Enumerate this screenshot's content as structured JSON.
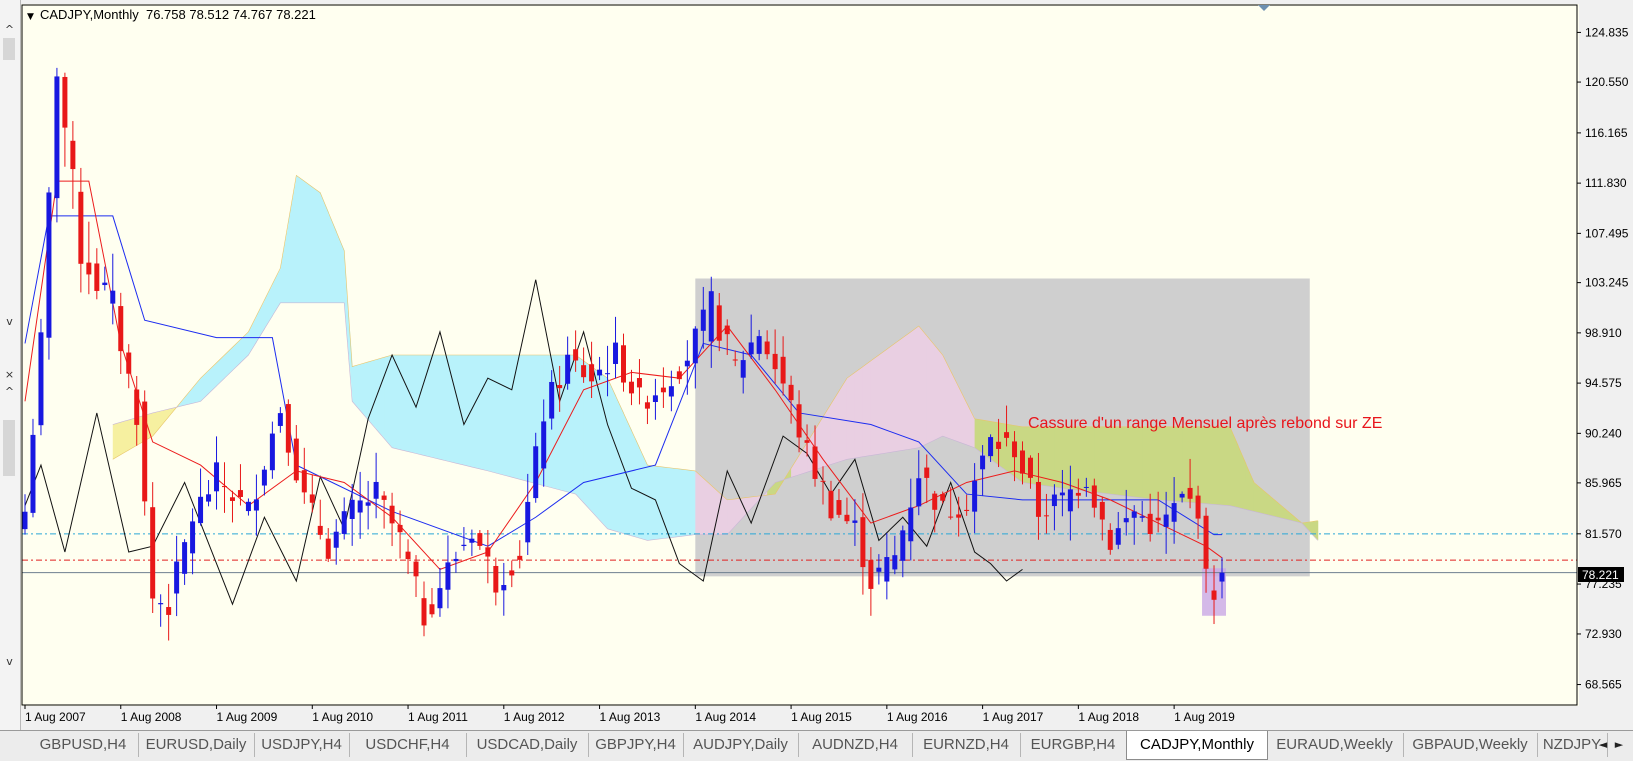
{
  "window": {
    "info_caret": "▼"
  },
  "left_strip": {
    "close_icon": "×",
    "arrow_up": "^",
    "arrow_down": "v"
  },
  "tabs": {
    "items": [
      {
        "label": "GBPUSD,H4",
        "active": false
      },
      {
        "label": "EURUSD,Daily",
        "active": false
      },
      {
        "label": "USDJPY,H4",
        "active": false
      },
      {
        "label": "USDCHF,H4",
        "active": false
      },
      {
        "label": "USDCAD,Daily",
        "active": false
      },
      {
        "label": "GBPJPY,H4",
        "active": false
      },
      {
        "label": "AUDJPY,Daily",
        "active": false
      },
      {
        "label": "AUDNZD,H4",
        "active": false
      },
      {
        "label": "EURNZD,H4",
        "active": false
      },
      {
        "label": "EURGBP,H4",
        "active": false
      },
      {
        "label": "CADJPY,Monthly",
        "active": true
      },
      {
        "label": "EURAUD,Weekly",
        "active": false
      },
      {
        "label": "GBPAUD,Weekly",
        "active": false
      },
      {
        "label": "NZDJPY",
        "active": false
      }
    ],
    "arrow_left": "◄",
    "arrow_right": "►"
  },
  "chart_data": {
    "type": "candlestick",
    "symbol_info": "CADJPY,Monthly  76.758 78.512 74.767 78.221",
    "annotation": "Cassure d'un range Mensuel après rebond sur ZE",
    "ylim": [
      66.8,
      127.2
    ],
    "price_ticks": [
      "124.835",
      "120.550",
      "116.165",
      "111.830",
      "107.495",
      "103.245",
      "98.910",
      "94.575",
      "90.240",
      "85.965",
      "81.570",
      "77.235",
      "72.930",
      "68.565"
    ],
    "current_price": "78.221",
    "x_labels": [
      "1 Aug 2007",
      "1 Aug 2008",
      "1 Aug 2009",
      "1 Aug 2010",
      "1 Aug 2011",
      "1 Aug 2012",
      "1 Aug 2013",
      "1 Aug 2014",
      "1 Aug 2015",
      "1 Aug 2016",
      "1 Aug 2017",
      "1 Aug 2018",
      "1 Aug 2019"
    ],
    "start_month": "2007-08",
    "horizontal_lines": [
      {
        "price": 81.57,
        "color": "#2aa6d6",
        "style": "dashdot"
      },
      {
        "price": 79.3,
        "color": "#e02020",
        "style": "dashdot"
      },
      {
        "price": 78.221,
        "color": "#6e7f8f",
        "style": "solid"
      }
    ],
    "range_box": {
      "from": "2014-08",
      "to": "2021-01",
      "high": 103.6,
      "low": 77.9,
      "color": "#cfcfcf"
    },
    "zone_box": {
      "from": "2019-12",
      "to": "2020-02",
      "high": 78.6,
      "low": 74.5,
      "color": "#c9a8e6"
    },
    "anchors": [
      {
        "m": "2007-08",
        "c": 83.5
      },
      {
        "m": "2007-10",
        "c": 98.0
      },
      {
        "m": "2007-12",
        "c": 122.0
      },
      {
        "m": "2008-03",
        "c": 106.0
      },
      {
        "m": "2008-07",
        "c": 101.0
      },
      {
        "m": "2008-10",
        "c": 92.0
      },
      {
        "m": "2008-12",
        "c": 76.0
      },
      {
        "m": "2009-02",
        "c": 75.5
      },
      {
        "m": "2009-05",
        "c": 83.0
      },
      {
        "m": "2009-08",
        "c": 86.5
      },
      {
        "m": "2009-12",
        "c": 83.5
      },
      {
        "m": "2010-04",
        "c": 92.5
      },
      {
        "m": "2010-07",
        "c": 84.5
      },
      {
        "m": "2010-10",
        "c": 80.5
      },
      {
        "m": "2011-01",
        "c": 83.5
      },
      {
        "m": "2011-04",
        "c": 85.0
      },
      {
        "m": "2011-07",
        "c": 81.0
      },
      {
        "m": "2011-10",
        "c": 74.5
      },
      {
        "m": "2012-01",
        "c": 78.5
      },
      {
        "m": "2012-04",
        "c": 82.0
      },
      {
        "m": "2012-07",
        "c": 77.5
      },
      {
        "m": "2012-10",
        "c": 80.0
      },
      {
        "m": "2013-01",
        "c": 92.0
      },
      {
        "m": "2013-04",
        "c": 96.5
      },
      {
        "m": "2013-07",
        "c": 95.0
      },
      {
        "m": "2013-10",
        "c": 97.0
      },
      {
        "m": "2014-01",
        "c": 93.0
      },
      {
        "m": "2014-04",
        "c": 94.5
      },
      {
        "m": "2014-07",
        "c": 97.0
      },
      {
        "m": "2014-10",
        "c": 101.0
      },
      {
        "m": "2015-01",
        "c": 96.0
      },
      {
        "m": "2015-04",
        "c": 99.0
      },
      {
        "m": "2015-07",
        "c": 94.5
      },
      {
        "m": "2015-10",
        "c": 88.5
      },
      {
        "m": "2016-01",
        "c": 84.0
      },
      {
        "m": "2016-04",
        "c": 82.0
      },
      {
        "m": "2016-06",
        "c": 77.5
      },
      {
        "m": "2016-09",
        "c": 79.5
      },
      {
        "m": "2016-12",
        "c": 87.0
      },
      {
        "m": "2017-03",
        "c": 83.5
      },
      {
        "m": "2017-06",
        "c": 84.5
      },
      {
        "m": "2017-09",
        "c": 89.5
      },
      {
        "m": "2017-12",
        "c": 89.0
      },
      {
        "m": "2018-03",
        "c": 83.5
      },
      {
        "m": "2018-06",
        "c": 84.5
      },
      {
        "m": "2018-09",
        "c": 86.5
      },
      {
        "m": "2018-12",
        "c": 81.0
      },
      {
        "m": "2019-03",
        "c": 83.5
      },
      {
        "m": "2019-06",
        "c": 82.0
      },
      {
        "m": "2019-09",
        "c": 84.5
      },
      {
        "m": "2019-11",
        "c": 84.0
      },
      {
        "m": "2019-12",
        "c": 77.5
      },
      {
        "m": "2020-01",
        "c": 76.8
      },
      {
        "m": "2020-02",
        "c": 78.221
      }
    ],
    "kumo_a": [
      {
        "m": "2008-07",
        "v": 88.0
      },
      {
        "m": "2008-12",
        "v": 90.0
      },
      {
        "m": "2009-06",
        "v": 95.0
      },
      {
        "m": "2009-12",
        "v": 99.0
      },
      {
        "m": "2010-04",
        "v": 104.5
      },
      {
        "m": "2010-06",
        "v": 112.5
      },
      {
        "m": "2010-09",
        "v": 111.0
      },
      {
        "m": "2010-12",
        "v": 106.0
      },
      {
        "m": "2011-01",
        "v": 96.0
      },
      {
        "m": "2011-06",
        "v": 97.0
      },
      {
        "m": "2012-06",
        "v": 97.0
      },
      {
        "m": "2013-05",
        "v": 97.0
      },
      {
        "m": "2013-09",
        "v": 95.0
      },
      {
        "m": "2014-02",
        "v": 87.5
      },
      {
        "m": "2014-08",
        "v": 87.0
      },
      {
        "m": "2014-12",
        "v": 84.5
      },
      {
        "m": "2015-06",
        "v": 85.0
      },
      {
        "m": "2016-03",
        "v": 95.0
      },
      {
        "m": "2016-12",
        "v": 99.5
      },
      {
        "m": "2017-03",
        "v": 97.0
      },
      {
        "m": "2017-07",
        "v": 91.5
      },
      {
        "m": "2018-01",
        "v": 90.8
      },
      {
        "m": "2018-06",
        "v": 90.8
      },
      {
        "m": "2019-06",
        "v": 90.8
      },
      {
        "m": "2020-03",
        "v": 90.8
      },
      {
        "m": "2020-06",
        "v": 86.0
      },
      {
        "m": "2020-12",
        "v": 82.5
      },
      {
        "m": "2021-02",
        "v": 82.7
      }
    ],
    "kumo_b": [
      {
        "m": "2008-07",
        "v": 91.0
      },
      {
        "m": "2008-12",
        "v": 92.0
      },
      {
        "m": "2009-06",
        "v": 93.0
      },
      {
        "m": "2009-12",
        "v": 97.0
      },
      {
        "m": "2010-04",
        "v": 101.5
      },
      {
        "m": "2010-06",
        "v": 101.5
      },
      {
        "m": "2010-09",
        "v": 101.5
      },
      {
        "m": "2010-12",
        "v": 101.5
      },
      {
        "m": "2011-01",
        "v": 93.0
      },
      {
        "m": "2011-06",
        "v": 89.0
      },
      {
        "m": "2012-06",
        "v": 87.0
      },
      {
        "m": "2013-05",
        "v": 85.0
      },
      {
        "m": "2013-09",
        "v": 82.0
      },
      {
        "m": "2014-02",
        "v": 81.0
      },
      {
        "m": "2014-08",
        "v": 81.5
      },
      {
        "m": "2014-12",
        "v": 81.5
      },
      {
        "m": "2015-06",
        "v": 86.0
      },
      {
        "m": "2016-03",
        "v": 88.0
      },
      {
        "m": "2016-12",
        "v": 89.0
      },
      {
        "m": "2017-03",
        "v": 90.0
      },
      {
        "m": "2017-07",
        "v": 89.0
      },
      {
        "m": "2018-01",
        "v": 86.0
      },
      {
        "m": "2018-06",
        "v": 85.5
      },
      {
        "m": "2019-06",
        "v": 84.5
      },
      {
        "m": "2020-03",
        "v": 84.0
      },
      {
        "m": "2020-06",
        "v": 83.5
      },
      {
        "m": "2020-12",
        "v": 82.5
      },
      {
        "m": "2021-02",
        "v": 81.0
      }
    ],
    "tenkan": [
      {
        "m": "2007-08",
        "v": 93.0
      },
      {
        "m": "2007-12",
        "v": 112.0
      },
      {
        "m": "2008-04",
        "v": 112.0
      },
      {
        "m": "2008-08",
        "v": 98.0
      },
      {
        "m": "2008-12",
        "v": 89.5
      },
      {
        "m": "2009-06",
        "v": 87.5
      },
      {
        "m": "2009-12",
        "v": 84.0
      },
      {
        "m": "2010-06",
        "v": 87.0
      },
      {
        "m": "2010-12",
        "v": 86.0
      },
      {
        "m": "2011-06",
        "v": 83.0
      },
      {
        "m": "2011-12",
        "v": 78.5
      },
      {
        "m": "2012-06",
        "v": 80.0
      },
      {
        "m": "2012-12",
        "v": 86.0
      },
      {
        "m": "2013-06",
        "v": 94.0
      },
      {
        "m": "2013-12",
        "v": 95.5
      },
      {
        "m": "2014-06",
        "v": 95.0
      },
      {
        "m": "2014-12",
        "v": 99.5
      },
      {
        "m": "2015-06",
        "v": 94.0
      },
      {
        "m": "2015-12",
        "v": 88.0
      },
      {
        "m": "2016-06",
        "v": 82.5
      },
      {
        "m": "2016-12",
        "v": 84.0
      },
      {
        "m": "2017-06",
        "v": 86.0
      },
      {
        "m": "2017-12",
        "v": 87.0
      },
      {
        "m": "2018-06",
        "v": 86.0
      },
      {
        "m": "2018-12",
        "v": 84.5
      },
      {
        "m": "2019-06",
        "v": 82.5
      },
      {
        "m": "2019-12",
        "v": 80.5
      },
      {
        "m": "2020-02",
        "v": 79.5
      }
    ],
    "kijun": [
      {
        "m": "2007-08",
        "v": 98.0
      },
      {
        "m": "2007-11",
        "v": 109.0
      },
      {
        "m": "2008-03",
        "v": 109.0
      },
      {
        "m": "2008-07",
        "v": 109.0
      },
      {
        "m": "2008-11",
        "v": 100.0
      },
      {
        "m": "2009-08",
        "v": 98.5
      },
      {
        "m": "2010-03",
        "v": 98.5
      },
      {
        "m": "2010-06",
        "v": 87.5
      },
      {
        "m": "2011-06",
        "v": 83.5
      },
      {
        "m": "2012-06",
        "v": 80.5
      },
      {
        "m": "2012-12",
        "v": 83.0
      },
      {
        "m": "2013-06",
        "v": 86.0
      },
      {
        "m": "2014-03",
        "v": 87.5
      },
      {
        "m": "2014-09",
        "v": 98.0
      },
      {
        "m": "2015-03",
        "v": 97.0
      },
      {
        "m": "2015-09",
        "v": 92.0
      },
      {
        "m": "2016-06",
        "v": 91.0
      },
      {
        "m": "2016-12",
        "v": 89.5
      },
      {
        "m": "2017-06",
        "v": 85.0
      },
      {
        "m": "2018-01",
        "v": 84.5
      },
      {
        "m": "2018-08",
        "v": 84.5
      },
      {
        "m": "2019-06",
        "v": 84.5
      },
      {
        "m": "2020-01",
        "v": 81.5
      },
      {
        "m": "2020-02",
        "v": 81.5
      }
    ],
    "chikou": [
      {
        "m": "2007-08",
        "v": 84.0
      },
      {
        "m": "2007-10",
        "v": 87.5
      },
      {
        "m": "2008-01",
        "v": 80.0
      },
      {
        "m": "2008-05",
        "v": 92.0
      },
      {
        "m": "2008-09",
        "v": 80.0
      },
      {
        "m": "2008-12",
        "v": 80.5
      },
      {
        "m": "2009-04",
        "v": 86.0
      },
      {
        "m": "2009-08",
        "v": 79.0
      },
      {
        "m": "2009-10",
        "v": 75.5
      },
      {
        "m": "2010-02",
        "v": 83.0
      },
      {
        "m": "2010-06",
        "v": 77.5
      },
      {
        "m": "2010-09",
        "v": 86.5
      },
      {
        "m": "2010-12",
        "v": 82.0
      },
      {
        "m": "2011-03",
        "v": 91.5
      },
      {
        "m": "2011-06",
        "v": 97.0
      },
      {
        "m": "2011-09",
        "v": 92.5
      },
      {
        "m": "2011-12",
        "v": 99.0
      },
      {
        "m": "2012-03",
        "v": 91.0
      },
      {
        "m": "2012-06",
        "v": 95.0
      },
      {
        "m": "2012-09",
        "v": 94.0
      },
      {
        "m": "2012-12",
        "v": 103.5
      },
      {
        "m": "2013-03",
        "v": 93.0
      },
      {
        "m": "2013-06",
        "v": 99.0
      },
      {
        "m": "2013-09",
        "v": 91.0
      },
      {
        "m": "2013-12",
        "v": 85.5
      },
      {
        "m": "2014-03",
        "v": 84.5
      },
      {
        "m": "2014-06",
        "v": 79.0
      },
      {
        "m": "2014-09",
        "v": 77.5
      },
      {
        "m": "2014-12",
        "v": 87.0
      },
      {
        "m": "2015-03",
        "v": 82.5
      },
      {
        "m": "2015-07",
        "v": 90.0
      },
      {
        "m": "2015-10",
        "v": 88.5
      },
      {
        "m": "2016-01",
        "v": 85.0
      },
      {
        "m": "2016-04",
        "v": 88.0
      },
      {
        "m": "2016-07",
        "v": 81.0
      },
      {
        "m": "2016-10",
        "v": 83.0
      },
      {
        "m": "2017-01",
        "v": 80.5
      },
      {
        "m": "2017-04",
        "v": 86.0
      },
      {
        "m": "2017-07",
        "v": 80.0
      },
      {
        "m": "2017-09",
        "v": 79.0
      },
      {
        "m": "2017-11",
        "v": 77.5
      },
      {
        "m": "2018-01",
        "v": 78.5
      }
    ]
  }
}
